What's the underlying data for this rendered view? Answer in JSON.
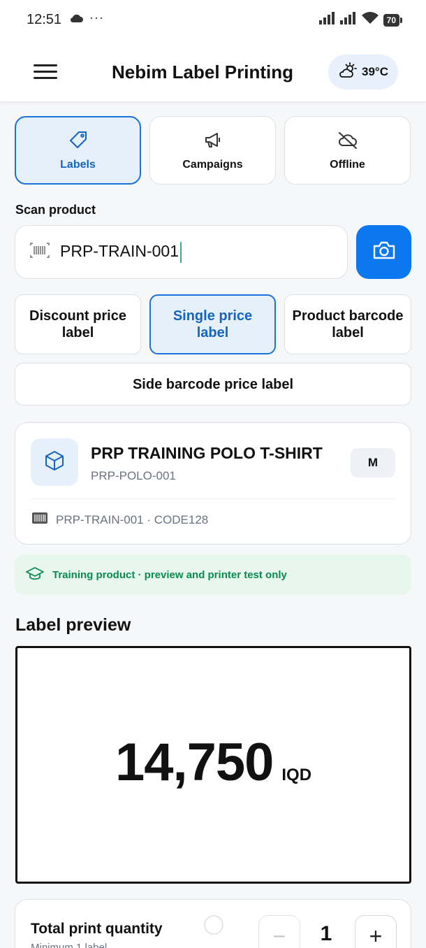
{
  "status_bar": {
    "time": "12:51",
    "dots": "···",
    "battery": "70"
  },
  "app_bar": {
    "title": "Nebim Label Printing",
    "weather": "39°C"
  },
  "tabs": [
    {
      "label": "Labels",
      "icon": "tag-icon",
      "active": true
    },
    {
      "label": "Campaigns",
      "icon": "megaphone-icon",
      "active": false
    },
    {
      "label": "Offline",
      "icon": "cloud-off-icon",
      "active": false
    }
  ],
  "scan": {
    "label": "Scan product",
    "value": "PRP-TRAIN-001"
  },
  "label_types": [
    {
      "label": "Discount price label",
      "active": false
    },
    {
      "label": "Single price label",
      "active": true
    },
    {
      "label": "Product barcode label",
      "active": false
    },
    {
      "label": "Side barcode price label",
      "active": false
    }
  ],
  "product": {
    "name": "PRP TRAINING POLO T-SHIRT",
    "code": "PRP-POLO-001",
    "size": "M",
    "barcode": "PRP-TRAIN-001 · CODE128"
  },
  "notice": "Training product · preview and printer test only",
  "preview": {
    "title": "Label preview",
    "price": "14,750",
    "currency": "IQD"
  },
  "quantity": {
    "title": "Total print quantity",
    "subtitle": "Minimum 1 label",
    "value": "1",
    "minus": "−",
    "plus": "+"
  },
  "colors": {
    "accent": "#0b78f0",
    "active_bg": "#e6f0fb",
    "notice_bg": "#e7f7ee",
    "notice_text": "#0a8a4f"
  }
}
